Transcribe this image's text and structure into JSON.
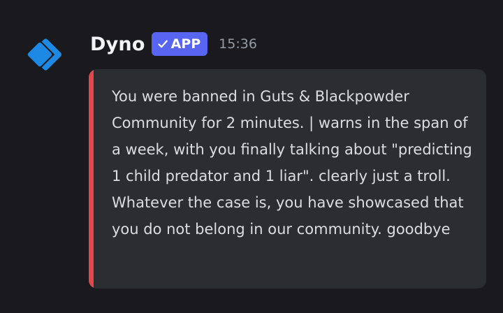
{
  "message": {
    "author": "Dyno",
    "badge": "APP",
    "timestamp": "15:36",
    "embed": {
      "accent_color": "#e0484c",
      "description": "You were banned in Guts & Blackpowder Community for 2 minutes. | warns in the span of a week, with you finally talking about \"predicting 1 child predator and 1 liar\". clearly just a troll. Whatever the case is, you have showcased that you do not belong in our community. goodbye"
    }
  },
  "colors": {
    "background": "#1a1a1e",
    "badge": "#5865f2",
    "embed_background": "#2b2d31",
    "avatar": "#1e88e5"
  },
  "icons": {
    "avatar": "dyno-logo-icon",
    "badge": "checkmark-icon"
  }
}
